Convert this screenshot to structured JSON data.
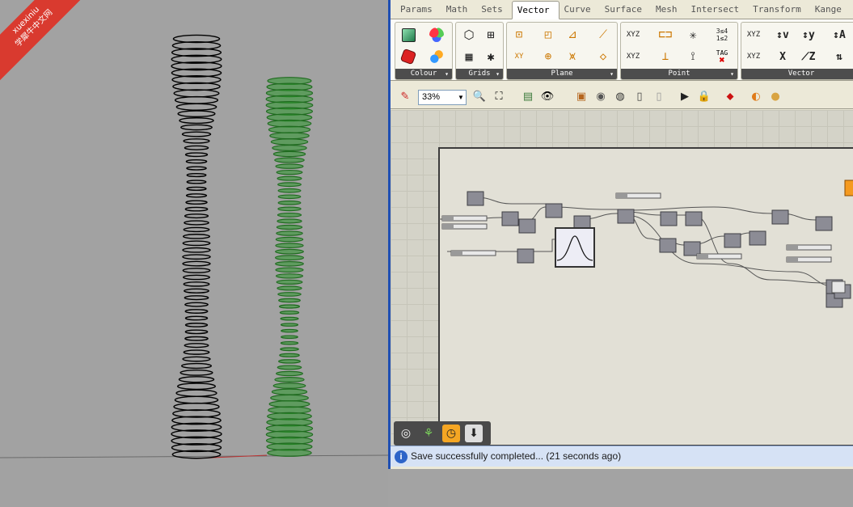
{
  "watermark": {
    "line1": "xuexiniu",
    "line2": "学犀牛中文网"
  },
  "grasshopper": {
    "tabs": [
      "Params",
      "Math",
      "Sets",
      "Vector",
      "Curve",
      "Surface",
      "Mesh",
      "Intersect",
      "Transform",
      "Kange"
    ],
    "active_tab": "Vector",
    "ribbon_groups": [
      "Colour",
      "Grids",
      "Plane",
      "Point",
      "Vector"
    ],
    "point_icons": {
      "xyz_top": "XYZ",
      "xyz_bottom": "XYZ",
      "tag": "TAG",
      "ratio": "3≤4 1≤2"
    },
    "vector_icons": {
      "xyz_a": "XYZ",
      "xyz_b": "XYZ",
      "v": "v",
      "y": "y",
      "x": "X",
      "z": "Z",
      "a": "A"
    },
    "plane_icons": {
      "xy": "XY"
    },
    "zoom": {
      "value": "33%"
    },
    "status": {
      "text": "Save successfully completed... (21 seconds ago)"
    }
  },
  "colors": {
    "tower_left": "#000000",
    "tower_right": "#2e8f2e",
    "node_fill": "#8c8c95",
    "status_bg": "#d6e2f5",
    "accent": "#f59a1f"
  }
}
